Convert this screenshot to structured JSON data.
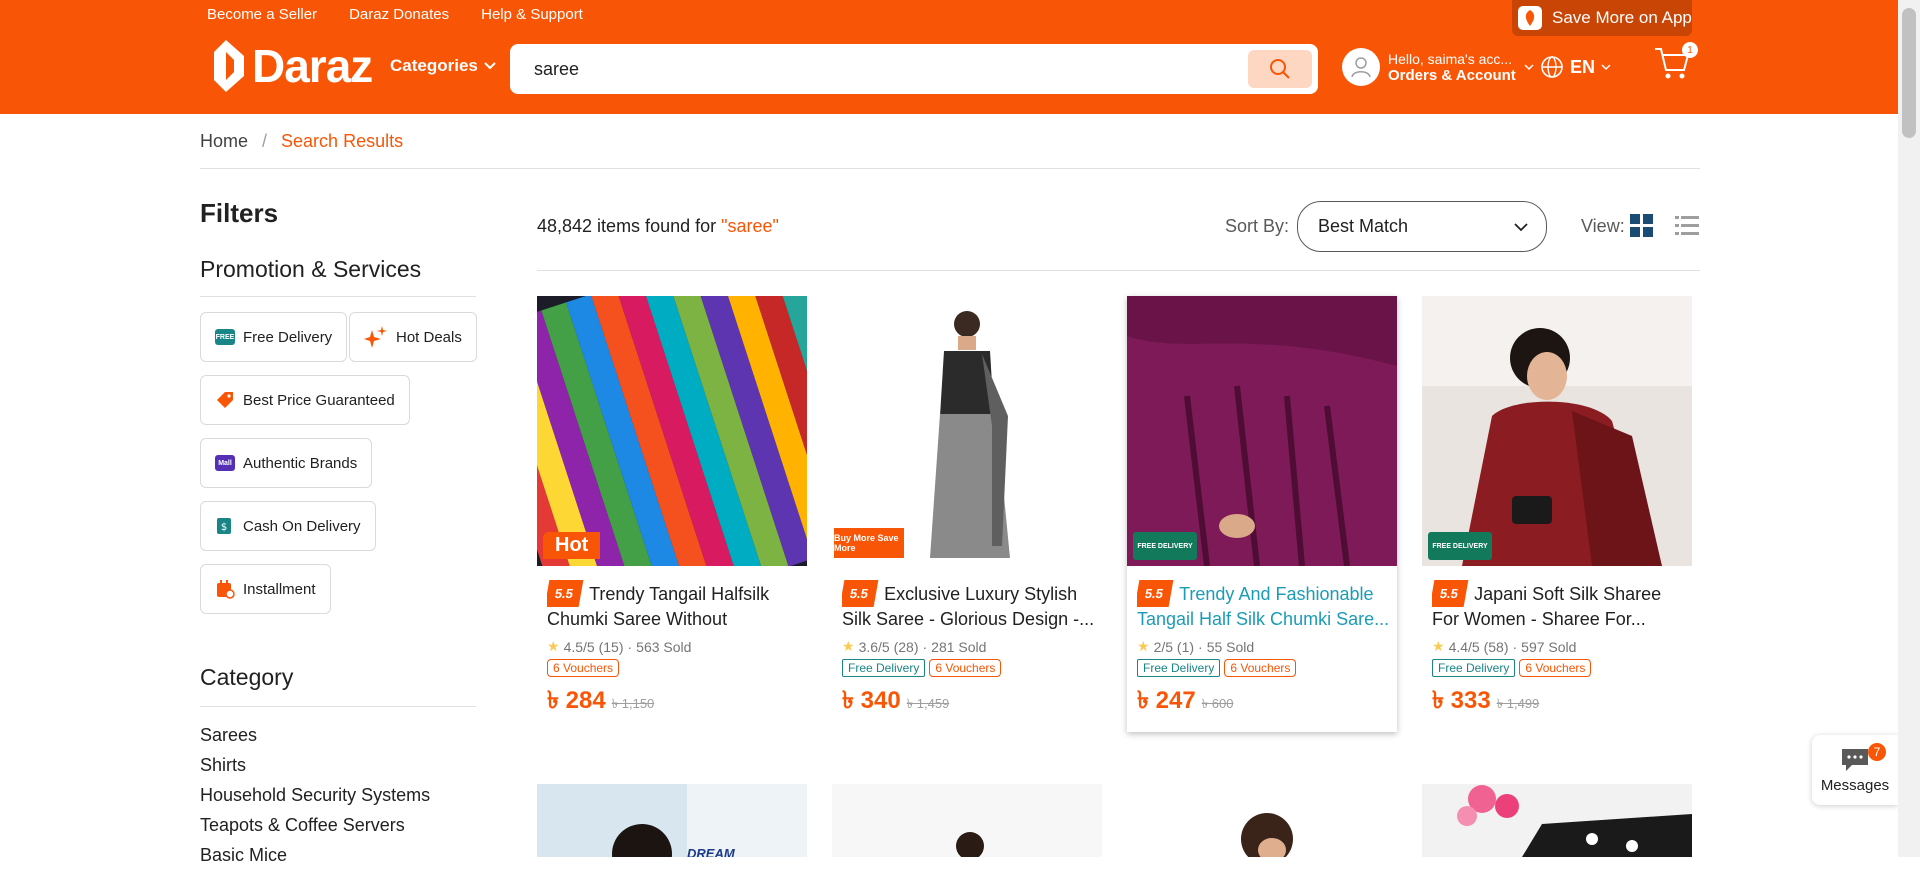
{
  "header": {
    "top_links": [
      "Become a Seller",
      "Daraz Donates",
      "Help & Support"
    ],
    "save_app": "Save More on App",
    "logo": "Daraz",
    "categories": "Categories",
    "search_value": "saree",
    "account_greeting": "Hello, saima's acc...",
    "account_label": "Orders & Account",
    "language": "EN",
    "cart_count": "1"
  },
  "breadcrumb": {
    "home": "Home",
    "current": "Search Results"
  },
  "sidebar": {
    "filters": "Filters",
    "promotion_title": "Promotion & Services",
    "chips": {
      "free_delivery": "Free Delivery",
      "hot_deals": "Hot Deals",
      "best_price": "Best Price Guaranteed",
      "authentic": "Authentic Brands",
      "cod": "Cash On Delivery",
      "installment": "Installment"
    },
    "category_title": "Category",
    "categories": [
      "Sarees",
      "Shirts",
      "Household Security Systems",
      "Teapots & Coffee Servers",
      "Basic Mice"
    ]
  },
  "results": {
    "count": "48,842 items found for ",
    "query": "\"saree\"",
    "sort_label": "Sort By:",
    "sort_value": "Best Match",
    "view_label": "View:"
  },
  "products": [
    {
      "tag": "5.5",
      "title": "Trendy Tangail Halfsilk Chumki Saree Without Blouse...",
      "rating": "4.5/5 (15)",
      "sold": "563 Sold",
      "free_delivery": "",
      "vouchers": "6 Vouchers",
      "price": "৳ 284",
      "old_price": "৳ 1,150",
      "image_badge": "Hot"
    },
    {
      "tag": "5.5",
      "title": "Exclusive Luxury Stylish Silk Saree - Glorious Design -...",
      "rating": "3.6/5 (28)",
      "sold": "281 Sold",
      "free_delivery": "Free Delivery",
      "vouchers": "6 Vouchers",
      "price": "৳ 340",
      "old_price": "৳ 1,459",
      "image_badge": "Buy More Save More"
    },
    {
      "tag": "5.5",
      "title": "Trendy And Fashionable Tangail Half Silk Chumki Sare...",
      "rating": "2/5 (1)",
      "sold": "55 Sold",
      "free_delivery": "Free Delivery",
      "vouchers": "6 Vouchers",
      "price": "৳ 247",
      "old_price": "৳ 600",
      "image_badge": "FREE DELIVERY"
    },
    {
      "tag": "5.5",
      "title": "Japani Soft Silk Sharee For Women - Sharee For...",
      "rating": "4.4/5 (58)",
      "sold": "597 Sold",
      "free_delivery": "Free Delivery",
      "vouchers": "6 Vouchers",
      "price": "৳ 333",
      "old_price": "৳ 1,499",
      "image_badge": "FREE DELIVERY"
    }
  ],
  "row2_badge": "DREAM TREASURE",
  "messages": {
    "label": "Messages",
    "count": "7"
  },
  "colors": {
    "brand": "#f85606",
    "free_delivery": "#1a8587",
    "link": "#1a9cb7"
  }
}
